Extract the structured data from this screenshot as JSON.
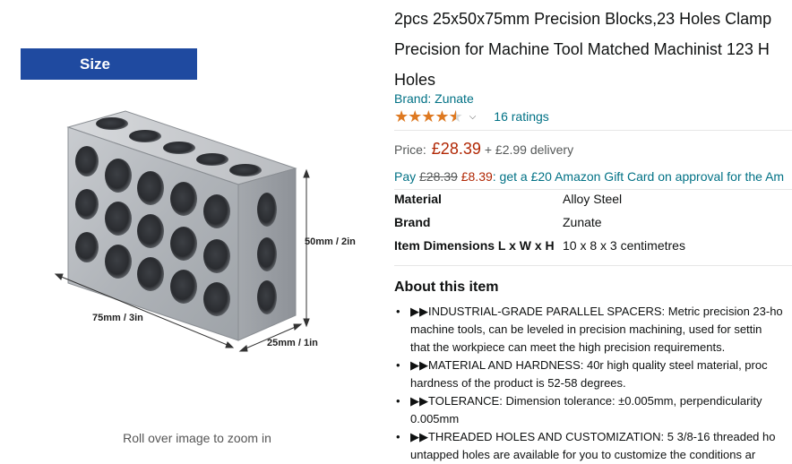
{
  "image_panel": {
    "size_banner": "Size",
    "dimensions": {
      "height": "50mm / 2in",
      "length": "75mm / 3in",
      "width": "25mm / 1in"
    },
    "zoom_hint": "Roll over image to zoom in"
  },
  "product": {
    "title_lines": [
      "2pcs 25x50x75mm Precision Blocks,23 Holes Clamp",
      "Precision for Machine Tool Matched Machinist 123 H",
      "Holes"
    ],
    "brand": "Brand: Zunate",
    "rating_stars": 4.5,
    "ratings": "16 ratings",
    "price_label": "Price:",
    "price": "£28.39",
    "delivery": "+ £2.99 delivery",
    "promo": {
      "pay": "Pay",
      "old_price": "£28.39",
      "new_price": "£8.39",
      "text": ": get a £20 Amazon Gift Card on approval for the Am"
    },
    "specs": [
      {
        "key": "Material",
        "value": "Alloy Steel"
      },
      {
        "key": "Brand",
        "value": "Zunate"
      },
      {
        "key": "Item Dimensions L x W x H",
        "value": "10 x 8 x 3 centimetres"
      }
    ],
    "about_title": "About this item",
    "bullets": [
      [
        "▶▶INDUSTRIAL-GRADE PARALLEL SPACERS: Metric precision 23-ho",
        "machine tools, can be leveled in precision machining, used for settin",
        "that the workpiece can meet the high precision requirements."
      ],
      [
        "▶▶MATERIAL AND HARDNESS: 40r high quality steel material, proc",
        "hardness of the product is 52-58 degrees."
      ],
      [
        "▶▶TOLERANCE: Dimension tolerance: ±0.005mm, perpendicularity",
        "0.005mm"
      ],
      [
        "▶▶THREADED HOLES AND CUSTOMIZATION: 5 3/8-16 threaded ho",
        "untapped holes are available for you to customize the conditions ar"
      ]
    ]
  },
  "colors": {
    "banner": "#1f4aa0",
    "link": "#007185",
    "price": "#b12704",
    "star": "#de7921"
  }
}
